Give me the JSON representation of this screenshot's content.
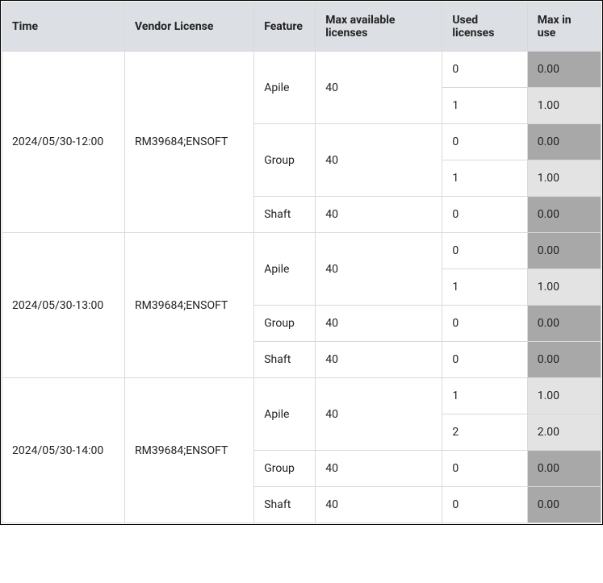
{
  "headers": {
    "time": "Time",
    "vendor": "Vendor License",
    "feature": "Feature",
    "maxAvail": "Max available licenses",
    "used": "Used licenses",
    "maxUse": "Max in use"
  },
  "groups": [
    {
      "time": "2024/05/30-12:00",
      "vendor": "RM39684;ENSOFT",
      "features": [
        {
          "name": "Apile",
          "maxAvail": "40",
          "rows": [
            {
              "used": "0",
              "maxUse": "0.00",
              "shade": "dark"
            },
            {
              "used": "1",
              "maxUse": "1.00",
              "shade": "light"
            }
          ]
        },
        {
          "name": "Group",
          "maxAvail": "40",
          "rows": [
            {
              "used": "0",
              "maxUse": "0.00",
              "shade": "dark"
            },
            {
              "used": "1",
              "maxUse": "1.00",
              "shade": "light"
            }
          ]
        },
        {
          "name": "Shaft",
          "maxAvail": "40",
          "rows": [
            {
              "used": "0",
              "maxUse": "0.00",
              "shade": "dark"
            }
          ]
        }
      ]
    },
    {
      "time": "2024/05/30-13:00",
      "vendor": "RM39684;ENSOFT",
      "features": [
        {
          "name": "Apile",
          "maxAvail": "40",
          "rows": [
            {
              "used": "0",
              "maxUse": "0.00",
              "shade": "dark"
            },
            {
              "used": "1",
              "maxUse": "1.00",
              "shade": "light"
            }
          ]
        },
        {
          "name": "Group",
          "maxAvail": "40",
          "rows": [
            {
              "used": "0",
              "maxUse": "0.00",
              "shade": "dark"
            }
          ]
        },
        {
          "name": "Shaft",
          "maxAvail": "40",
          "rows": [
            {
              "used": "0",
              "maxUse": "0.00",
              "shade": "dark"
            }
          ]
        }
      ]
    },
    {
      "time": "2024/05/30-14:00",
      "vendor": "RM39684;ENSOFT",
      "features": [
        {
          "name": "Apile",
          "maxAvail": "40",
          "rows": [
            {
              "used": "1",
              "maxUse": "1.00",
              "shade": "light"
            },
            {
              "used": "2",
              "maxUse": "2.00",
              "shade": "light"
            }
          ]
        },
        {
          "name": "Group",
          "maxAvail": "40",
          "rows": [
            {
              "used": "0",
              "maxUse": "0.00",
              "shade": "dark"
            }
          ]
        },
        {
          "name": "Shaft",
          "maxAvail": "40",
          "rows": [
            {
              "used": "0",
              "maxUse": "0.00",
              "shade": "dark"
            }
          ]
        }
      ]
    }
  ]
}
